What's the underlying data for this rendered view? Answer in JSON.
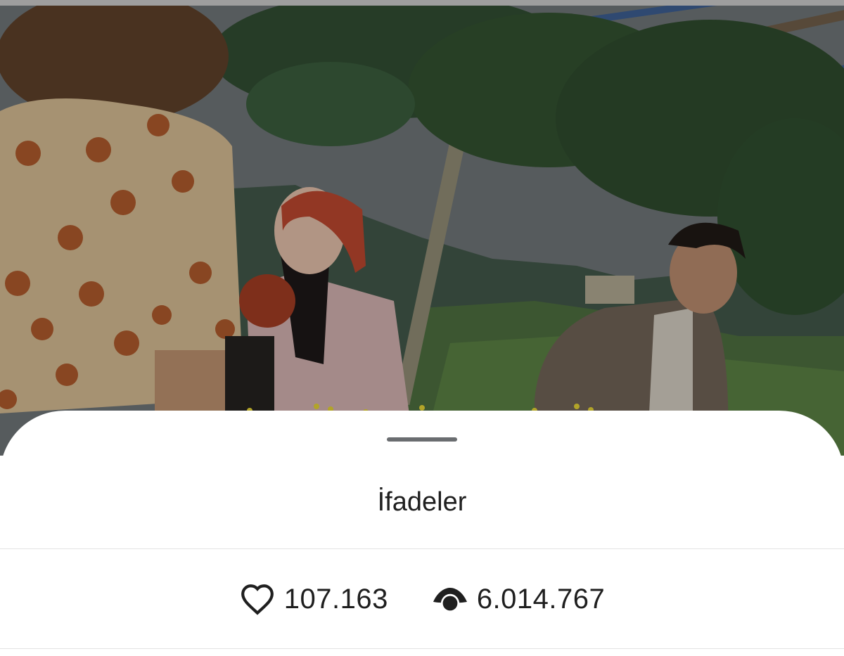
{
  "sheet": {
    "title": "İfadeler"
  },
  "stats": {
    "likes": {
      "icon": "heart-outline-icon",
      "value": "107.163"
    },
    "views": {
      "icon": "eye-icon",
      "value": "6.014.767"
    }
  },
  "colors": {
    "sheet_background": "#ffffff",
    "handle": "#6a6d70",
    "text": "#1f1f1f",
    "divider": "#e3e3e3"
  }
}
